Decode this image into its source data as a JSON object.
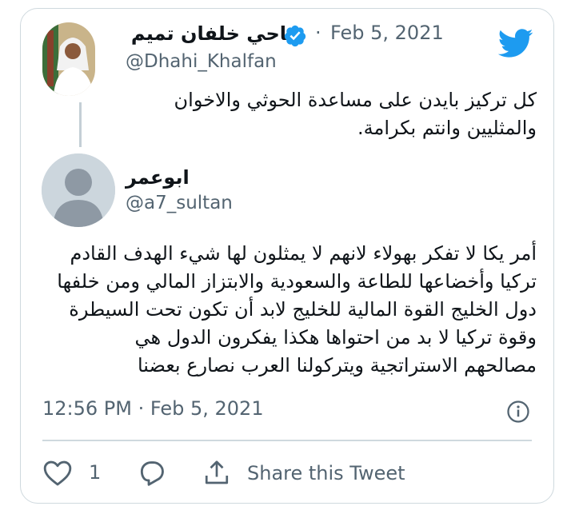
{
  "colors": {
    "twitter_blue": "#1d9bf0",
    "muted_text": "#536471",
    "border": "#cfd9de"
  },
  "quoted_tweet": {
    "display_name": "ضاحي خلفان تميم",
    "verified": true,
    "separator": "·",
    "date": "Feb 5, 2021",
    "handle": "@Dhahi_Khalfan",
    "text": "كل تركيز بايدن على مساعدة الحوثي والاخوان والمثليين وانتم بكرامة."
  },
  "reply_tweet": {
    "display_name": "ابوعمر",
    "handle": "@a7_sultan",
    "text": "أمر يكا لا تفكر بهولاء  لانهم لا يمثلون لها شيء الهدف القادم\nتركيا وأخضاعها للطاعة والسعودية والابتزاز المالي ومن خلفها\nدول الخليج القوة المالية للخليج لابد أن تكون تحت السيطرة\nوقوة تركيا لا بد من احتواها  هكذا يفكرون الدول هي\nمصالحهم الاستراتجية ويتركولنا العرب نصارع بعضنا"
  },
  "meta": {
    "timestamp": "12:56 PM · Feb 5, 2021"
  },
  "actions": {
    "like_count": "1",
    "share_label": "Share this Tweet"
  },
  "icons": {
    "brand": "twitter-bird-icon",
    "verified": "verified-badge-icon",
    "info": "info-icon",
    "like": "heart-icon",
    "reply": "reply-icon",
    "share": "share-icon"
  }
}
